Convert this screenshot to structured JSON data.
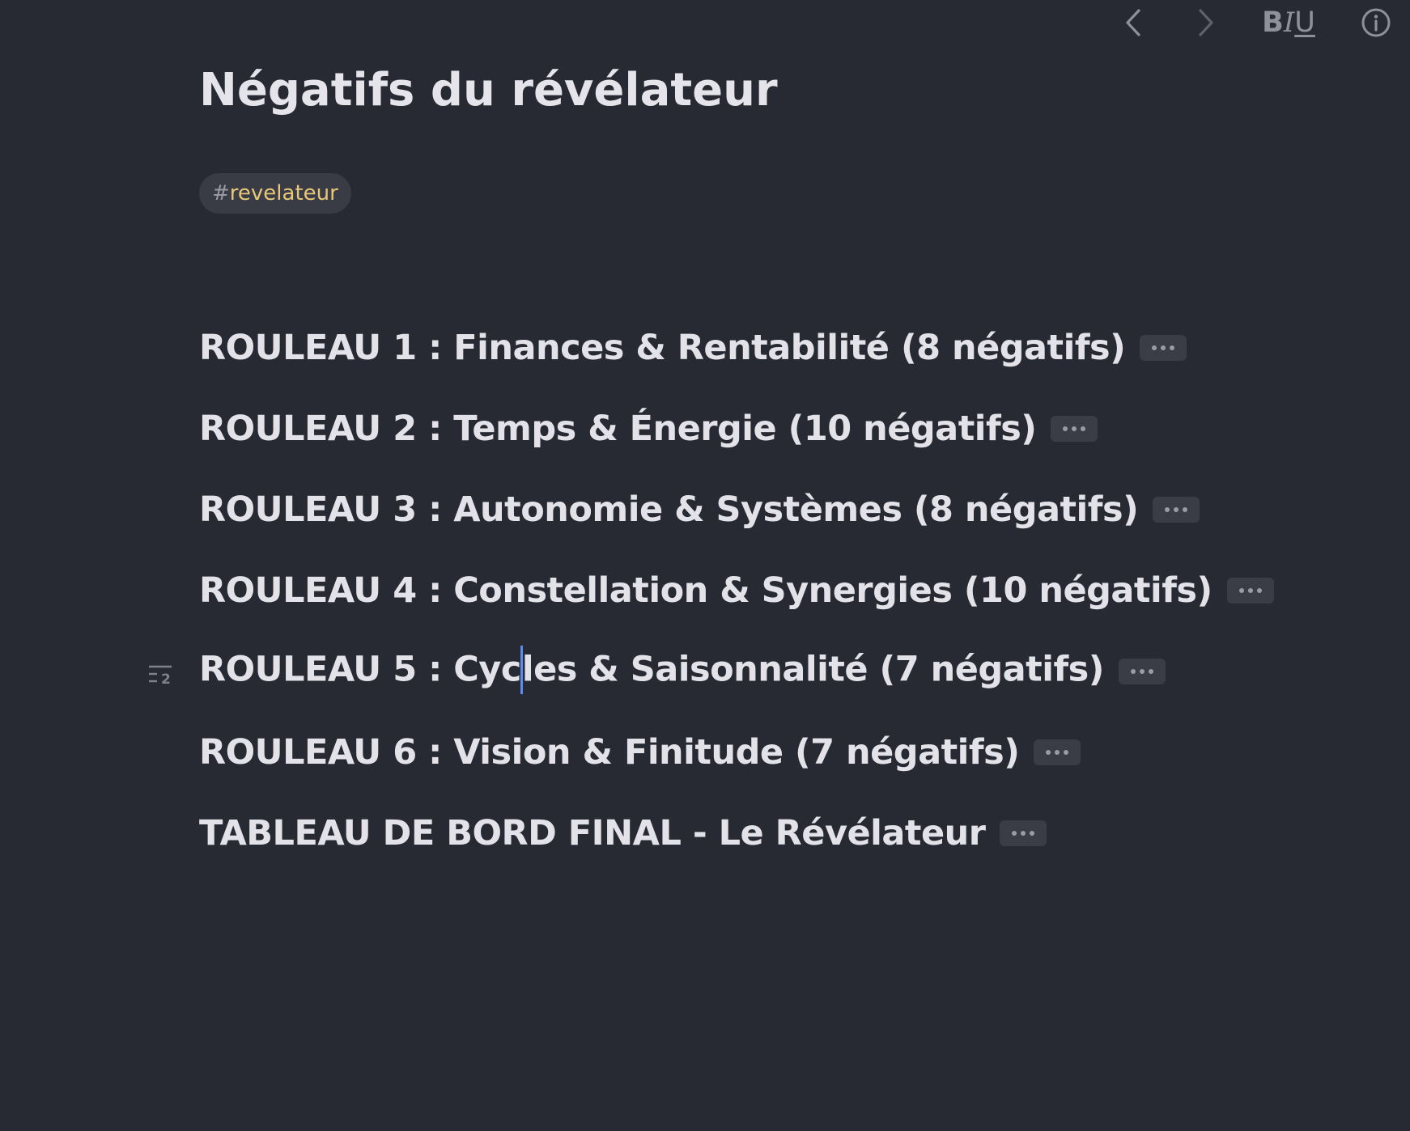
{
  "toolbar": {
    "back_icon": "chevron-left-icon",
    "forward_icon": "chevron-right-icon",
    "format": {
      "bold": "B",
      "italic": "I",
      "underline": "U"
    },
    "info_icon": "info-icon"
  },
  "note": {
    "title": "Négatifs du révélateur",
    "tag": {
      "hash": "#",
      "name": "revelateur"
    },
    "headings": [
      {
        "text": "ROULEAU 1 : Finances & Rentabilité (8 négatifs)"
      },
      {
        "text": "ROULEAU 2 : Temps & Énergie (10 négatifs)"
      },
      {
        "text": "ROULEAU 3 : Autonomie & Systèmes (8 négatifs)"
      },
      {
        "text": "ROULEAU 4 : Constellation & Synergies (10 négatifs)"
      },
      {
        "text_before_cursor": "ROULEAU 5 : Cyc",
        "text_after_cursor": "les & Saisonnalité (7 négatifs)"
      },
      {
        "text": "ROULEAU 6 : Vision & Finitude (7 négatifs)"
      },
      {
        "text": "TABLEAU DE BORD FINAL - Le Révélateur"
      }
    ],
    "active_heading_level": "2"
  },
  "colors": {
    "background": "#282a33",
    "text": "#e2e2e8",
    "tag_text": "#e9c779",
    "tag_background": "#393b45",
    "cursor": "#5b8def"
  }
}
